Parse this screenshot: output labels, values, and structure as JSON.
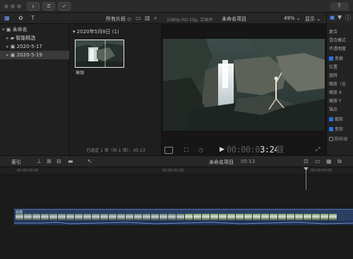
{
  "toolbar": {
    "download_icon": "download-icon",
    "key_icon": "key-icon",
    "check_icon": "check-circle-icon"
  },
  "browser_header": {
    "filter_label": "所有片段 ◇",
    "viewer_info": "1080p HD 25p, 立体声",
    "project_title": "未命名项目",
    "zoom": "49%",
    "zoom_caret": "⌄",
    "display_label": "显示 ⌄"
  },
  "library": {
    "name": "未命名",
    "items": [
      {
        "label": "智能精选"
      },
      {
        "label": "2020-5-17"
      },
      {
        "label": "2020-5-19"
      }
    ]
  },
  "event": {
    "date_header": "2020年5月8日",
    "count": "(1)",
    "clip_name": "瑜伽",
    "status": "已选定 1 项（共 1 项），05:13"
  },
  "viewer": {
    "timecode": "00:00:03:24",
    "timecode_dim": "00:00:0",
    "timecode_bright": "3:24"
  },
  "inspector": {
    "rows": [
      {
        "label": "复合"
      },
      {
        "label": "混合模式"
      },
      {
        "label": "不透明度"
      },
      {
        "label": "变换",
        "checked": true
      },
      {
        "label": "位置"
      },
      {
        "label": "旋转"
      },
      {
        "label": "缩放（全"
      },
      {
        "label": "缩放 X"
      },
      {
        "label": "缩放 Y"
      },
      {
        "label": "锚点"
      },
      {
        "label": "裁剪",
        "checked": true
      },
      {
        "label": "变形",
        "checked": true
      },
      {
        "label": "防抖动",
        "checked": false
      }
    ]
  },
  "timeline": {
    "index_label": "索引",
    "project_name": "未命名项目",
    "duration": "05:13",
    "ruler_marks": [
      "00:00:00:00",
      "00:00:02:00",
      "00:00:04:00"
    ],
    "clip_label": "瑜伽"
  }
}
